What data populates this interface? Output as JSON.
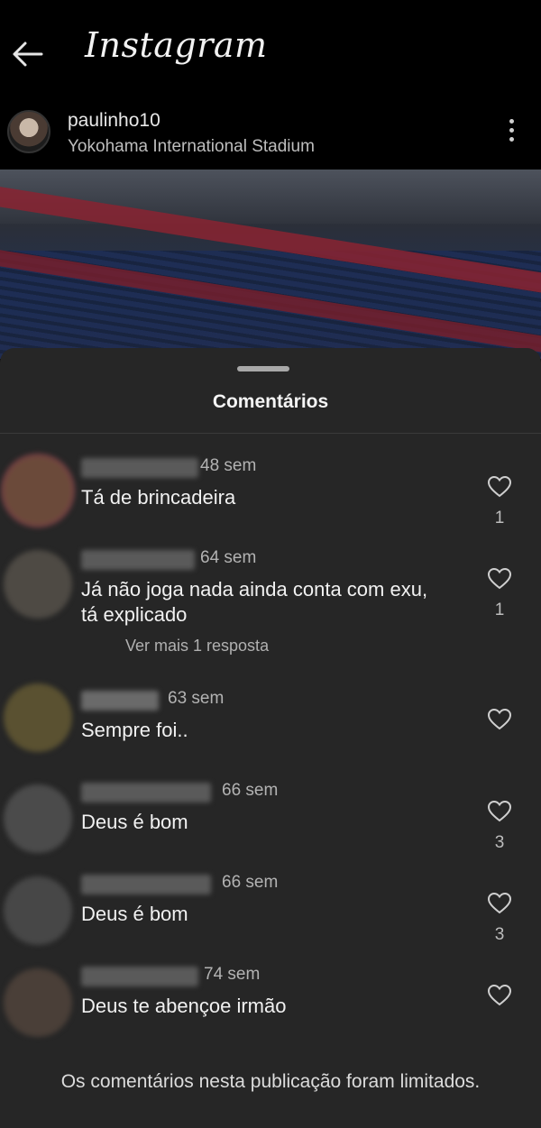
{
  "app": {
    "title": "Instagram",
    "back_icon": "arrow-left-icon"
  },
  "post": {
    "username": "paulinho10",
    "location": "Yokohama International Stadium",
    "more_icon": "more-vertical-icon"
  },
  "sheet": {
    "title": "Comentários"
  },
  "comments": [
    {
      "time": "48 sem",
      "text": "Tá de brincadeira",
      "likes": "1",
      "avatar_color": "#6b4a3a"
    },
    {
      "time": "64 sem",
      "text": "Já não joga nada ainda conta com exu, tá explicado",
      "likes": "1",
      "reply": "Ver mais 1 resposta",
      "avatar_color": "#4e4a44"
    },
    {
      "time": "63 sem",
      "text": "Sempre foi..",
      "likes": "",
      "avatar_color": "#5a5131"
    },
    {
      "time": "66 sem",
      "text": "Deus é bom",
      "likes": "3",
      "avatar_color": "#4b4b4b"
    },
    {
      "time": "66 sem",
      "text": "Deus é bom",
      "likes": "3",
      "avatar_color": "#474747"
    },
    {
      "time": "74 sem",
      "text": "Deus te abençoe irmão",
      "likes": "",
      "avatar_color": "#4a3f38"
    }
  ],
  "footer": {
    "limited_notice": "Os comentários nesta publicação foram limitados."
  },
  "colors": {
    "sheet_bg": "#262626",
    "top_bg": "#000000",
    "text_primary": "#f1f1f1",
    "text_secondary": "#b3b3b3"
  }
}
